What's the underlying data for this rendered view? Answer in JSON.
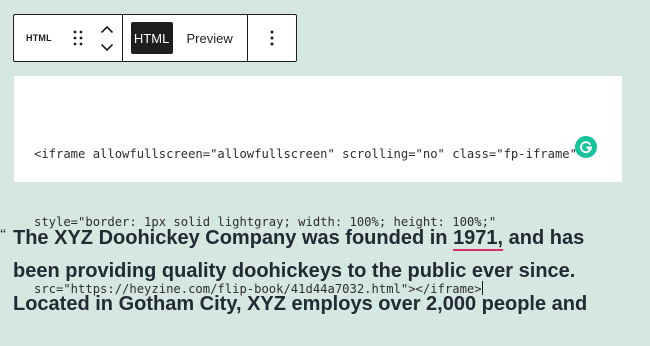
{
  "toolbar": {
    "block_icon_label": "HTML",
    "drag_icon": "drag-handle-icon",
    "move_up_icon": "chevron-up-icon",
    "move_down_icon": "chevron-down-icon",
    "html_mode_label": "HTML",
    "preview_mode_label": "Preview",
    "active_mode": "HTML",
    "more_icon": "more-vertical-icon"
  },
  "code_editor": {
    "lines": [
      "<iframe allowfullscreen=\"allowfullscreen\" scrolling=\"no\" class=\"fp-iframe\"",
      "style=\"border: 1px solid lightgray; width: 100%; height: 100%;\"",
      "src=\"https://heyzine.com/flip-book/41d44a7032.html\"></iframe>"
    ],
    "assistant_icon": "grammarly-icon"
  },
  "paragraph": {
    "quote_mark": "“",
    "line1_before": "The XYZ Doohickey Company was founded in ",
    "line1_flagged": "1971,",
    "line1_after": " and has",
    "line2": "been providing quality doohickeys to the public ever since.",
    "line3": "Located in Gotham City, XYZ employs over 2,000 people and"
  },
  "colors": {
    "page_background": "#d6e6e0",
    "toolbar_border": "#1e1e1e",
    "active_mode_background": "#1e1e1e",
    "grammarly_green": "#15c39a",
    "spelling_underline": "#d6336c"
  }
}
